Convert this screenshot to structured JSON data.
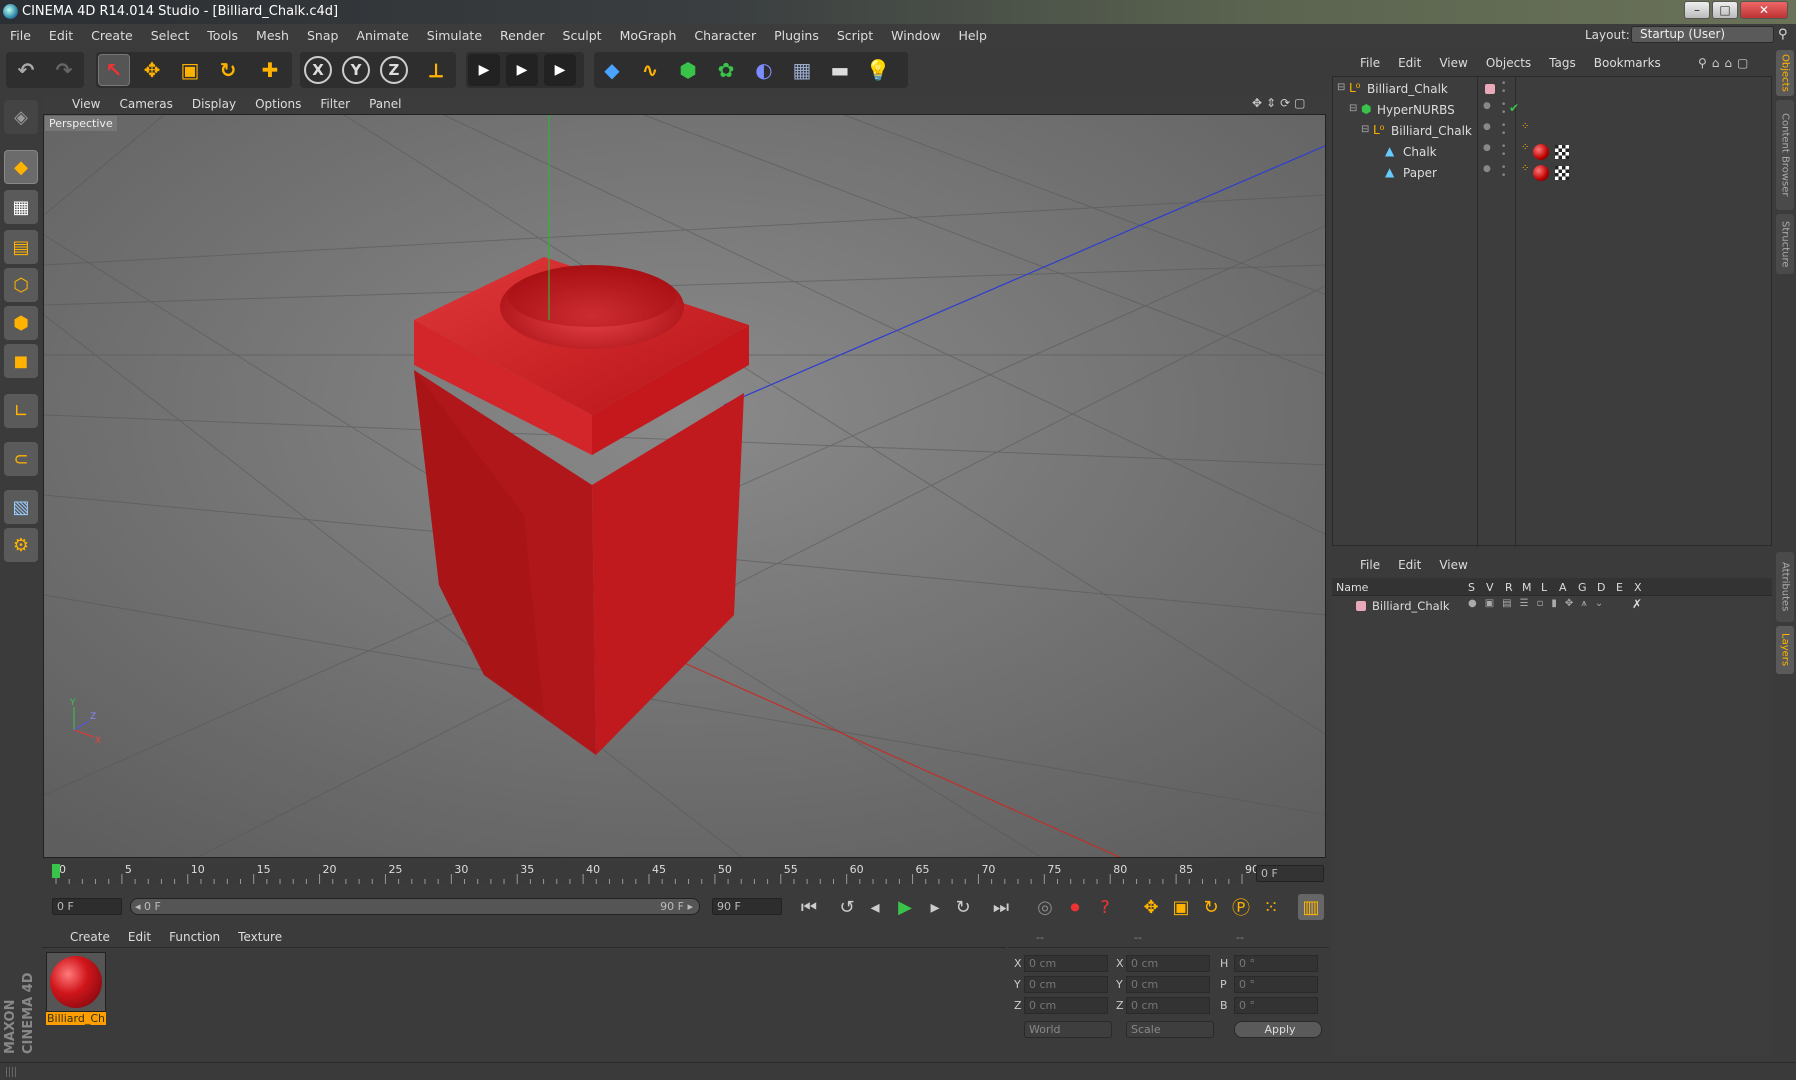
{
  "window": {
    "title": "CINEMA 4D R14.014 Studio - [Billiard_Chalk.c4d]",
    "minimize": "–",
    "maximize": "□",
    "close": "✕"
  },
  "menubar": [
    "File",
    "Edit",
    "Create",
    "Select",
    "Tools",
    "Mesh",
    "Snap",
    "Animate",
    "Simulate",
    "Render",
    "Sculpt",
    "MoGraph",
    "Character",
    "Plugins",
    "Script",
    "Window",
    "Help"
  ],
  "layout": {
    "label": "Layout:",
    "value": "Startup (User)"
  },
  "toolbar": {
    "undo": "↶",
    "redo": "↷",
    "select": "↖",
    "move": "✥",
    "scale": "▣",
    "rotate": "↻",
    "create": "✚",
    "x_axis": "X",
    "y_axis": "Y",
    "z_axis": "Z",
    "coord": "⟂",
    "render_view": "▶",
    "render": "▶",
    "render_settings": "▶",
    "cube": "◆",
    "spline": "∿",
    "nurbs": "⬢",
    "mograph": "✿",
    "deformer": "◐",
    "scene": "▦",
    "camera": "▬",
    "light": "💡"
  },
  "viewport": {
    "menu": [
      "View",
      "Cameras",
      "Display",
      "Options",
      "Filter",
      "Panel"
    ],
    "label": "Perspective",
    "axes": {
      "y": "Y",
      "z": "Z",
      "x": "X"
    }
  },
  "timeline": {
    "ticks": [
      "0",
      "5",
      "10",
      "15",
      "20",
      "25",
      "30",
      "35",
      "40",
      "45",
      "50",
      "55",
      "60",
      "65",
      "70",
      "75",
      "80",
      "85",
      "90"
    ],
    "current_frame": "0 F"
  },
  "transport": {
    "start": "0 F",
    "range_start": "◂ 0 F",
    "range_end": "90 F ▸",
    "end": "90 F"
  },
  "materials": {
    "menu": [
      "Create",
      "Edit",
      "Function",
      "Texture"
    ],
    "items": [
      {
        "name": "Billiard_Ch"
      }
    ]
  },
  "coordinates": {
    "headers": [
      "--",
      "--",
      "--"
    ],
    "rows": [
      {
        "l1": "X",
        "v1": "0 cm",
        "l2": "X",
        "v2": "0 cm",
        "l3": "H",
        "v3": "0 °"
      },
      {
        "l1": "Y",
        "v1": "0 cm",
        "l2": "Y",
        "v2": "0 cm",
        "l3": "P",
        "v3": "0 °"
      },
      {
        "l1": "Z",
        "v1": "0 cm",
        "l2": "Z",
        "v2": "0 cm",
        "l3": "B",
        "v3": "0 °"
      }
    ],
    "mode": "World",
    "scale": "Scale",
    "apply": "Apply"
  },
  "objects": {
    "menu": [
      "File",
      "Edit",
      "View",
      "Objects",
      "Tags",
      "Bookmarks"
    ],
    "rows": [
      {
        "name": "Billiard_Chalk"
      },
      {
        "name": "HyperNURBS"
      },
      {
        "name": "Billiard_Chalk"
      },
      {
        "name": "Chalk"
      },
      {
        "name": "Paper"
      }
    ]
  },
  "layers": {
    "menu": [
      "File",
      "Edit",
      "View"
    ],
    "columns": [
      "Name",
      "S",
      "V",
      "R",
      "M",
      "L",
      "A",
      "G",
      "D",
      "E",
      "X"
    ],
    "rows": [
      {
        "name": "Billiard_Chalk"
      }
    ]
  },
  "sidetabs": [
    "Objects",
    "Content Browser",
    "Structure",
    "Attributes",
    "Layers"
  ],
  "brand": "MAXON CINEMA 4D",
  "colors": {
    "accent": "#ff9e00",
    "chalk": "#c8171c",
    "green": "#39c34a"
  }
}
